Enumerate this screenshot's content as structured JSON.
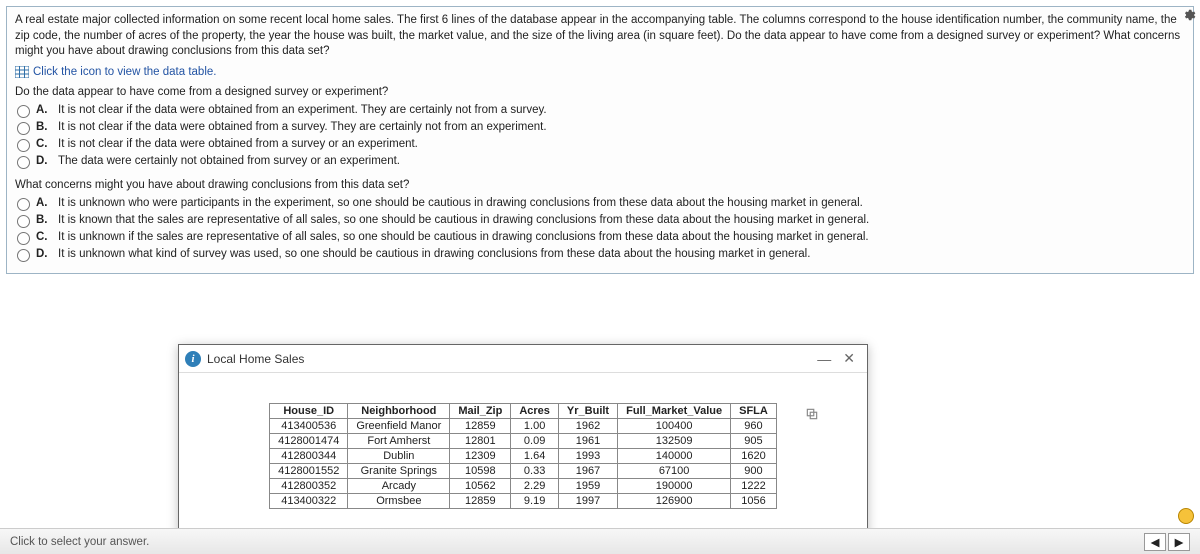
{
  "intro": "A real estate major collected information on some recent local home sales. The first 6 lines of the database appear in the accompanying table. The columns correspond to the house identification number, the community name, the zip code, the number of acres of the property, the year the house was built, the market value, and the size of the living area (in square feet). Do the data appear to have come from a designed survey or experiment? What concerns might you have about drawing conclusions from this data set?",
  "table_link": "Click the icon to view the data table.",
  "q1": {
    "prompt": "Do the data appear to have come from a designed survey or experiment?",
    "A": "It is not clear if the data were obtained from an experiment. They are certainly not from a survey.",
    "B": "It is not clear if the data were obtained from a survey. They are certainly not from an experiment.",
    "C": "It is not clear if the data were obtained from a survey or an experiment.",
    "D": "The data were certainly not obtained from survey or an experiment."
  },
  "q2": {
    "prompt": "What concerns might you have about drawing conclusions from this data set?",
    "A": "It is unknown who were participants in the experiment, so one should be cautious in drawing conclusions from these data about the housing market in general.",
    "B": "It is known that the sales are representative of all sales, so one should be cautious in drawing conclusions from these data about the housing market in general.",
    "C": "It is unknown if the sales are representative of all sales, so one should be cautious in drawing conclusions from these data about the housing market in general.",
    "D": "It is unknown what kind of survey was used, so one should be cautious in drawing conclusions from these data about the housing market in general."
  },
  "dialog": {
    "title": "Local Home Sales",
    "headers": [
      "House_ID",
      "Neighborhood",
      "Mail_Zip",
      "Acres",
      "Yr_Built",
      "Full_Market_Value",
      "SFLA"
    ],
    "rows": [
      [
        "413400536",
        "Greenfield Manor",
        "12859",
        "1.00",
        "1962",
        "100400",
        "960"
      ],
      [
        "4128001474",
        "Fort Amherst",
        "12801",
        "0.09",
        "1961",
        "132509",
        "905"
      ],
      [
        "412800344",
        "Dublin",
        "12309",
        "1.64",
        "1993",
        "140000",
        "1620"
      ],
      [
        "4128001552",
        "Granite Springs",
        "10598",
        "0.33",
        "1967",
        "67100",
        "900"
      ],
      [
        "412800352",
        "Arcady",
        "10562",
        "2.29",
        "1959",
        "190000",
        "1222"
      ],
      [
        "413400322",
        "Ormsbee",
        "12859",
        "9.19",
        "1997",
        "126900",
        "1056"
      ]
    ]
  },
  "footer": "Click to select your answer."
}
